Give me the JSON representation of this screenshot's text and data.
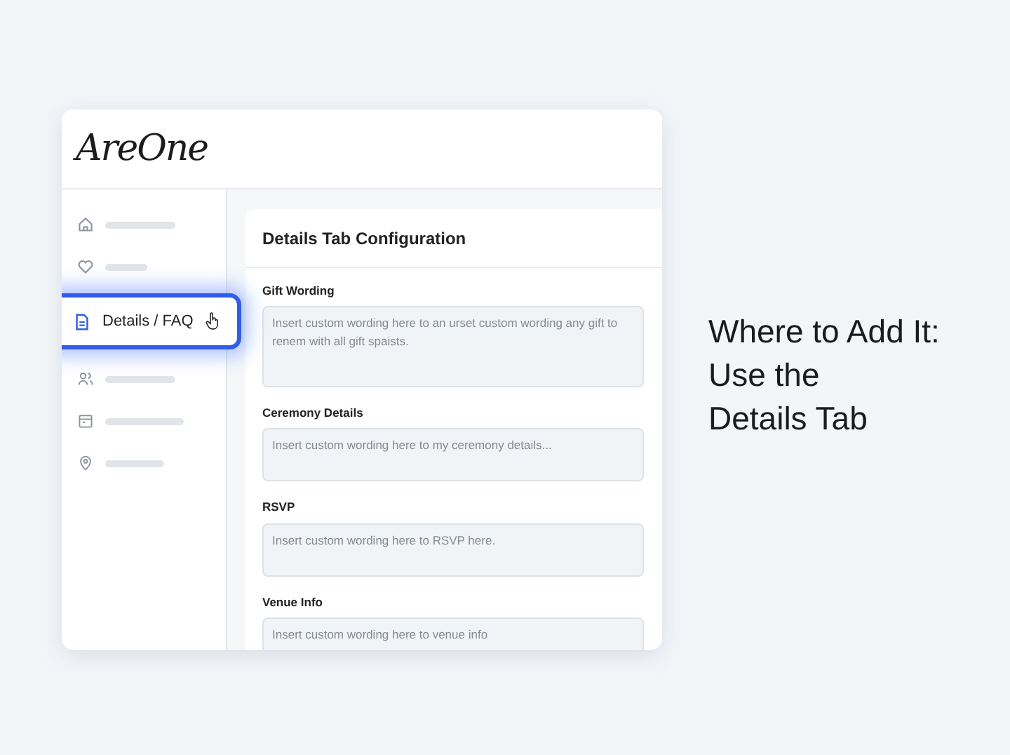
{
  "logo": "AreOne",
  "sidebar": {
    "items": [
      {
        "kind": "home",
        "selected": false
      },
      {
        "kind": "heart",
        "selected": false
      },
      {
        "kind": "document",
        "label": "Details / FAQ",
        "selected": true
      },
      {
        "kind": "people",
        "selected": false
      },
      {
        "kind": "calendar",
        "selected": false
      },
      {
        "kind": "pin",
        "selected": false
      }
    ]
  },
  "panel": {
    "title": "Details Tab Configuration",
    "fields": [
      {
        "label": "Gift Wording",
        "placeholder": "Insert custom wording here to an urset custom wording any gift to renem with all gift spaists.",
        "kind": "tall"
      },
      {
        "label": "Ceremony Details",
        "placeholder": "Insert custom wording here to my ceremony details...",
        "kind": "short"
      },
      {
        "label": "RSVP",
        "placeholder": "Insert custom wording here to RSVP here.",
        "kind": "short"
      },
      {
        "label": "Venue Info",
        "placeholder": "Insert custom wording here to venue info",
        "kind": "short"
      }
    ]
  },
  "caption": [
    "Where to Add It:",
    "Use the",
    "Details Tab"
  ]
}
